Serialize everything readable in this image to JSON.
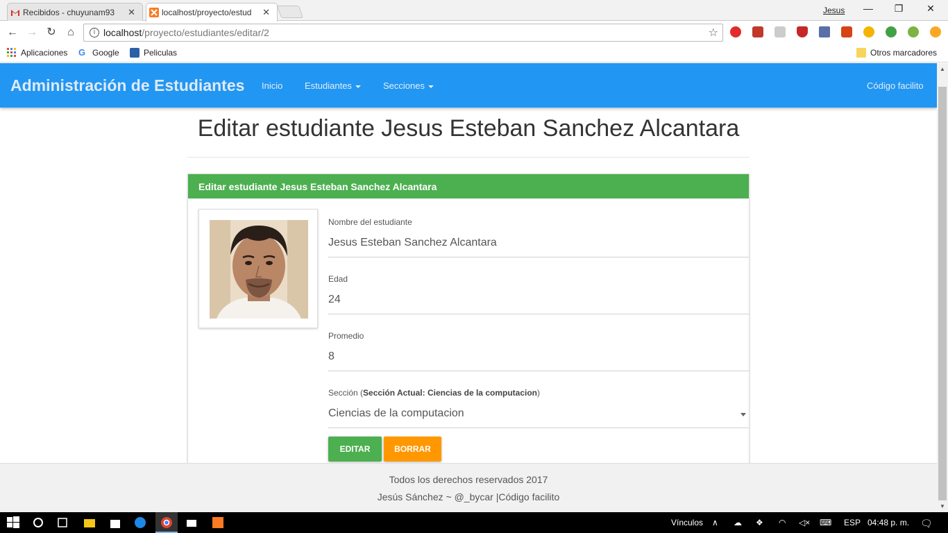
{
  "browser": {
    "tabs": [
      {
        "label": "Recibidos - chuyunam93",
        "icon": "gmail-icon",
        "active": false
      },
      {
        "label": "localhost/proyecto/estud",
        "icon": "xampp-icon",
        "active": true
      }
    ],
    "user": "Jesus",
    "url_host": "localhost",
    "url_path": "/proyecto/estudiantes/editar/2",
    "bookmarks": [
      {
        "label": "Aplicaciones",
        "icon": "apps-grid-icon"
      },
      {
        "label": "Google",
        "icon": "google-icon"
      },
      {
        "label": "Peliculas",
        "icon": "bookmark-icon"
      }
    ],
    "other_bookmarks": "Otros marcadores"
  },
  "navbar": {
    "brand": "Administración de Estudiantes",
    "links": [
      "Inicio",
      "Estudiantes",
      "Secciones"
    ],
    "right_link": "Código facilito",
    "color": "#2196f3"
  },
  "page": {
    "title": "Editar estudiante Jesus Esteban Sanchez Alcantara",
    "panel_heading": "Editar estudiante Jesus Esteban Sanchez Alcantara",
    "form": {
      "name_label": "Nombre del estudiante",
      "name_value": "Jesus Esteban Sanchez Alcantara",
      "age_label": "Edad",
      "age_value": "24",
      "avg_label": "Promedio",
      "avg_value": "8",
      "section_label_prefix": "Sección (",
      "section_label_bold": "Sección Actual: Ciencias de la computacion",
      "section_label_suffix": ")",
      "section_value": "Ciencias de la computacion"
    },
    "buttons": {
      "edit": "EDITAR",
      "delete": "BORRAR"
    }
  },
  "footer": {
    "line1": "Todos los derechos reservados 2017",
    "line2": "Jesús Sánchez ~ @_bycar |Código facilito"
  },
  "taskbar": {
    "links_label": "Vínculos",
    "lang": "ESP",
    "time": "04:48 p. m."
  },
  "colors": {
    "success": "#4caf50",
    "warning": "#ff9800",
    "primary": "#2196f3"
  }
}
